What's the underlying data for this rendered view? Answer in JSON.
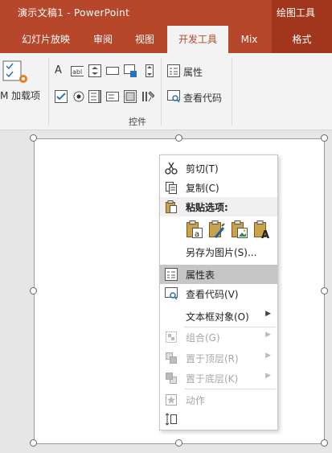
{
  "window": {
    "title": "演示文稿1  -  PowerPoint",
    "context_group": "绘图工具"
  },
  "tabs": [
    {
      "label": "幻灯片放映",
      "state": "normal"
    },
    {
      "label": "审阅",
      "state": "normal"
    },
    {
      "label": "视图",
      "state": "normal"
    },
    {
      "label": "开发工具",
      "state": "active"
    },
    {
      "label": "Mix",
      "state": "normal"
    },
    {
      "label": "格式",
      "state": "context"
    }
  ],
  "ribbon": {
    "addins_label": "M 加载项",
    "properties_label": "属性",
    "view_code_label": "查看代码",
    "controls_group_label": "控件",
    "control_letter": "A",
    "textbox_text": "abl"
  },
  "context_menu": {
    "items": [
      {
        "label": "剪切(T)",
        "icon": "scissors-icon",
        "enabled": true,
        "highlighted": false,
        "submenu": false
      },
      {
        "label": "复制(C)",
        "icon": "copy-icon",
        "enabled": true,
        "highlighted": false,
        "submenu": false
      },
      {
        "label": "粘贴选项:",
        "icon": "paste-icon",
        "enabled": true,
        "highlighted": false,
        "submenu": false,
        "header": true
      },
      {
        "label": "另存为图片(S)...",
        "icon": "",
        "enabled": true,
        "highlighted": false,
        "submenu": false
      },
      {
        "label": "属性表",
        "icon": "property-sheet-icon",
        "enabled": true,
        "highlighted": true,
        "submenu": false
      },
      {
        "label": "查看代码(V)",
        "icon": "view-code-icon",
        "enabled": true,
        "highlighted": false,
        "submenu": false
      },
      {
        "label": "文本框对象(O)",
        "icon": "",
        "enabled": true,
        "highlighted": false,
        "submenu": true
      },
      {
        "label": "组合(G)",
        "icon": "group-icon",
        "enabled": false,
        "highlighted": false,
        "submenu": true
      },
      {
        "label": "置于顶层(R)",
        "icon": "bring-front-icon",
        "enabled": false,
        "highlighted": false,
        "submenu": true
      },
      {
        "label": "置于底层(K)",
        "icon": "send-back-icon",
        "enabled": false,
        "highlighted": false,
        "submenu": true
      },
      {
        "label": "动作",
        "icon": "action-icon",
        "enabled": false,
        "highlighted": false,
        "submenu": false
      }
    ],
    "paste_options": [
      "paste-keep-text-icon",
      "paste-format-icon",
      "paste-picture-icon",
      "paste-text-only-icon"
    ],
    "paste_letter_a": "a",
    "paste_letter_A": "A"
  },
  "colors": {
    "accent": "#b7472a",
    "accent_dark": "#a1361c",
    "ribbon_bg": "#f3f3f3",
    "highlight": "#c6c6c6"
  }
}
